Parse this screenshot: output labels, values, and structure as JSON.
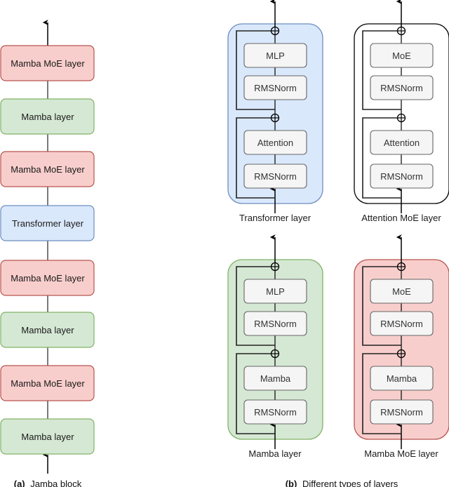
{
  "panel_a": {
    "caption_prefix": "(a)",
    "caption": "Jamba block",
    "layers": [
      {
        "label": "Mamba MoE layer",
        "kind": "mamba_moe"
      },
      {
        "label": "Mamba layer",
        "kind": "mamba"
      },
      {
        "label": "Mamba MoE layer",
        "kind": "mamba_moe"
      },
      {
        "label": "Transformer layer",
        "kind": "transformer"
      },
      {
        "label": "Mamba MoE layer",
        "kind": "mamba_moe"
      },
      {
        "label": "Mamba layer",
        "kind": "mamba"
      },
      {
        "label": "Mamba MoE layer",
        "kind": "mamba_moe"
      },
      {
        "label": "Mamba layer",
        "kind": "mamba"
      }
    ]
  },
  "panel_b": {
    "caption_prefix": "(b)",
    "caption": "Different types of layers",
    "layer_types": [
      {
        "title": "Transformer layer",
        "kind": "transformer",
        "blocks": [
          "MLP",
          "RMSNorm",
          "Attention",
          "RMSNorm"
        ]
      },
      {
        "title": "Attention MoE layer",
        "kind": "attention_moe",
        "blocks": [
          "MoE",
          "RMSNorm",
          "Attention",
          "RMSNorm"
        ]
      },
      {
        "title": "Mamba layer",
        "kind": "mamba",
        "blocks": [
          "MLP",
          "RMSNorm",
          "Mamba",
          "RMSNorm"
        ]
      },
      {
        "title": "Mamba MoE layer",
        "kind": "mamba_moe",
        "blocks": [
          "MoE",
          "RMSNorm",
          "Mamba",
          "RMSNorm"
        ]
      }
    ]
  },
  "colors": {
    "mamba_moe": {
      "fill": "#f8cecc",
      "stroke": "#b85450"
    },
    "mamba": {
      "fill": "#d5e8d4",
      "stroke": "#82b366"
    },
    "transformer": {
      "fill": "#dae8fc",
      "stroke": "#6c8ebf"
    },
    "attention_moe": {
      "fill": "#ffffff",
      "stroke": "#000000"
    },
    "inner_block": {
      "fill": "#f5f5f5",
      "stroke": "#666666"
    }
  }
}
